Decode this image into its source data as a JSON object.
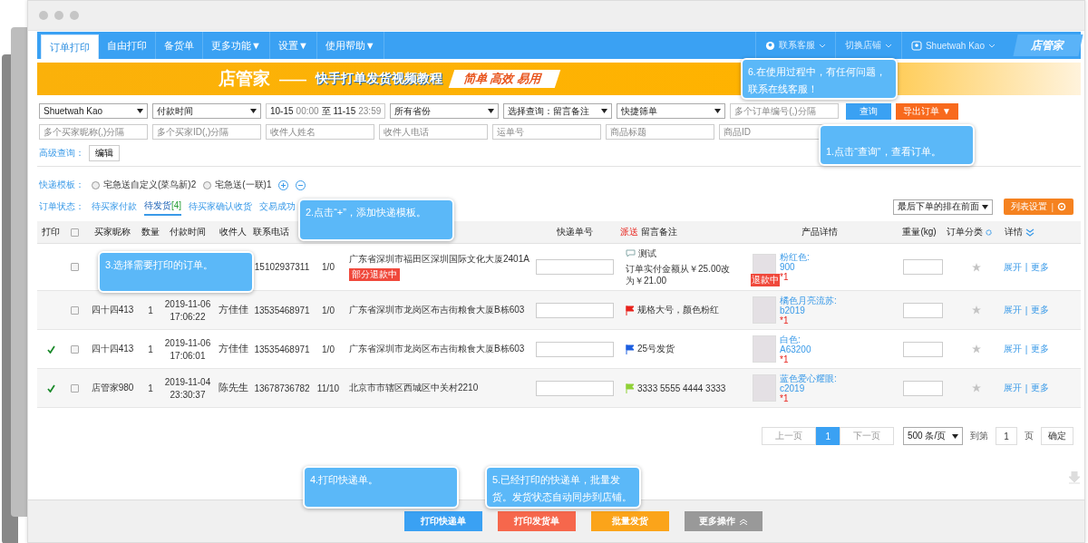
{
  "nav": {
    "items": [
      {
        "label": "订单打印",
        "selected": true
      },
      {
        "label": "自由打印",
        "selected": false
      },
      {
        "label": "备货单",
        "selected": false
      },
      {
        "label": "更多功能",
        "selected": false,
        "caret": "▼"
      },
      {
        "label": "设置",
        "selected": false,
        "caret": "▼"
      },
      {
        "label": "使用帮助",
        "selected": false,
        "caret": "▼"
      }
    ],
    "right": [
      {
        "label": "联系客服",
        "kind": "service"
      },
      {
        "label": "切换店铺",
        "kind": "shop"
      },
      {
        "label": "Shuetwah Kao",
        "kind": "account"
      }
    ],
    "brand": "店管家"
  },
  "banner": {
    "brand": "店管家",
    "dash": "——",
    "title": "快手打单发货视频教程",
    "slogan": "简单 高效 易用"
  },
  "filters": [
    [
      {
        "kind": "select",
        "value": "Shuetwah Kao"
      },
      {
        "kind": "select",
        "value": "付款时间"
      },
      {
        "kind": "daterange",
        "from": "10-15",
        "from_time": "00:00",
        "sep": "至",
        "to": "11-15",
        "to_time": "23:59"
      },
      {
        "kind": "select",
        "value": "所有省份"
      },
      {
        "kind": "select",
        "value": "选择查询：留言备注"
      },
      {
        "kind": "select",
        "value": "快捷筛单"
      },
      {
        "kind": "input",
        "placeholder": "多个订单编号(,)分隔"
      },
      {
        "kind": "button",
        "label": "查询"
      },
      {
        "kind": "export",
        "label": "导出订单",
        "caret": "▼"
      }
    ],
    [
      {
        "kind": "input",
        "placeholder": "多个买家昵称(,)分隔"
      },
      {
        "kind": "input",
        "placeholder": "多个买家ID(,)分隔"
      },
      {
        "kind": "input",
        "placeholder": "收件人姓名"
      },
      {
        "kind": "input",
        "placeholder": "收件人电话"
      },
      {
        "kind": "input",
        "placeholder": "运单号"
      },
      {
        "kind": "input",
        "placeholder": "商品标题"
      },
      {
        "kind": "input",
        "placeholder": "商品ID"
      }
    ]
  ],
  "advanced": {
    "label": "高级查询：",
    "button": "编辑"
  },
  "templates": {
    "label": "快递模板：",
    "options": [
      {
        "label": "宅急送自定义(菜鸟新)2",
        "selected": false
      },
      {
        "label": "宅急送(一联)1",
        "selected": false
      }
    ]
  },
  "status": {
    "label": "订单状态：",
    "tabs": [
      {
        "label": "待买家付款",
        "selected": false
      },
      {
        "label": "待发货",
        "count": "[4]",
        "selected": true
      },
      {
        "label": "待买家确认收货",
        "selected": false
      },
      {
        "label": "交易成功",
        "selected": false
      }
    ]
  },
  "sort": {
    "value": "最后下单的排在前面"
  },
  "list_settings": {
    "label": "列表设置",
    "sep": "|"
  },
  "table": {
    "header_checked": false,
    "columns": [
      {
        "label": "打印"
      },
      {
        "label": "买家昵称"
      },
      {
        "label": "数量"
      },
      {
        "label": "付款时间"
      },
      {
        "label": "收件人"
      },
      {
        "label": "联系电话"
      },
      {
        "label": "快递单号"
      },
      {
        "label": "留言备注",
        "tag": "派送"
      },
      {
        "label": "产品详情"
      },
      {
        "label": "重量(kg)"
      },
      {
        "label": "订单分类"
      },
      {
        "label": "详情"
      }
    ],
    "rows": [
      {
        "printed": false,
        "checked": false,
        "phone": "15102937311",
        "ratio": "1/0",
        "address": "广东省深圳市福田区深圳国际文化大厦2401A",
        "tag": "部分退款中",
        "note": {
          "kind": "message",
          "title": "测试",
          "text": "订单实付金额从￥25.00改为￥21.00"
        },
        "product": {
          "name": "粉红色:",
          "sku": "900",
          "qty": "*1",
          "badge": "退款中"
        },
        "starred": false,
        "links": [
          "展开",
          "|",
          "更多"
        ]
      },
      {
        "printed": false,
        "checked": false,
        "buyer": "四十四413",
        "qty": "1",
        "date": "2019-11-06",
        "time": "17:06:22",
        "recipient": "方佳佳",
        "phone": "13535468971",
        "ratio": "1/0",
        "address": "广东省深圳市龙岗区布吉街粮食大厦B栋603",
        "note": {
          "kind": "flag",
          "color": "#e8231c",
          "text": "规格大号，颜色粉红"
        },
        "product": {
          "name": "橘色月亮流苏:",
          "sku": "b2019",
          "qty": "*1"
        },
        "starred": false,
        "links": [
          "展开",
          "|",
          "更多"
        ]
      },
      {
        "printed": true,
        "checked": false,
        "buyer": "四十四413",
        "qty": "1",
        "date": "2019-11-06",
        "time": "17:06:01",
        "recipient": "方佳佳",
        "phone": "13535468971",
        "ratio": "1/0",
        "address": "广东省深圳市龙岗区布吉街粮食大厦B栋603",
        "note": {
          "kind": "flag",
          "color": "#1d5fe0",
          "text": "25号发货"
        },
        "product": {
          "name": "白色:",
          "sku": "A63200",
          "qty": "*1"
        },
        "starred": false,
        "links": [
          "展开",
          "|",
          "更多"
        ]
      },
      {
        "printed": true,
        "checked": false,
        "buyer": "店管家980",
        "qty": "1",
        "date": "2019-11-04",
        "time": "23:30:37",
        "recipient": "陈先生",
        "phone": "13678736782",
        "ratio": "11/10",
        "address": "北京市市辖区西城区中关村2210",
        "note": {
          "kind": "flag",
          "color": "#8fd136",
          "text": "3333 5555 4444 3333"
        },
        "product": {
          "name": "蓝色爱心耀眼:",
          "sku": "c2019",
          "qty": "*1"
        },
        "starred": false,
        "links": [
          "展开",
          "|",
          "更多"
        ]
      }
    ]
  },
  "pagination": {
    "prev": "上一页",
    "pages": [
      {
        "label": "1",
        "selected": true
      }
    ],
    "next": "下一页",
    "size": "500 条/页",
    "goto": "到第",
    "page": "1",
    "unit": "页",
    "confirm": "确定"
  },
  "actions": [
    {
      "label": "打印快递单",
      "kind": "primary"
    },
    {
      "label": "打印发货单",
      "kind": "danger"
    },
    {
      "label": "批量发货",
      "kind": "warning"
    },
    {
      "label": "更多操作",
      "kind": "more"
    }
  ],
  "callouts": [
    "1.点击“查询”，查看订单。",
    "2.点击“+”，添加快递模板。",
    "3.选择需要打印的订单。",
    "4.打印快递单。",
    "5.已经打印的快递单，批量发货。发货状态自动同步到店铺。",
    "6.在使用过程中，有任何问题，联系在线客服！"
  ]
}
